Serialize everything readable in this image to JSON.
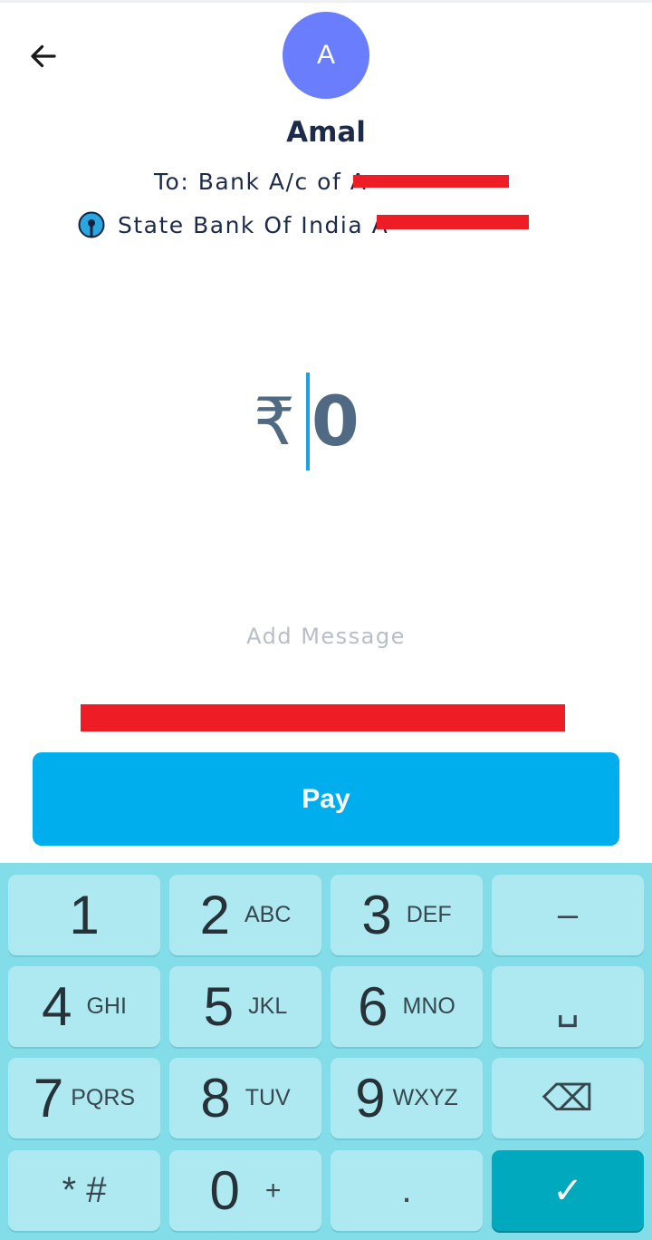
{
  "header": {
    "back_icon": "arrow-left-icon",
    "avatar_letter": "A",
    "payee_name": "Amal",
    "to_prefix": "To: Bank A/c of A",
    "bank_name": "State Bank Of India A",
    "bank_icon": "sbi-logo-icon"
  },
  "amount": {
    "currency_symbol": "₹",
    "value": "0"
  },
  "message": {
    "placeholder": "Add Message"
  },
  "pay_button": {
    "label": "Pay",
    "color": "#00aded"
  },
  "keypad": {
    "keys": [
      {
        "digit": "1",
        "letters": ""
      },
      {
        "digit": "2",
        "letters": "ABC"
      },
      {
        "digit": "3",
        "letters": "DEF"
      },
      {
        "digit": "–",
        "letters": ""
      },
      {
        "digit": "4",
        "letters": "GHI"
      },
      {
        "digit": "5",
        "letters": "JKL"
      },
      {
        "digit": "6",
        "letters": "MNO"
      },
      {
        "digit": "␣",
        "letters": ""
      },
      {
        "digit": "7",
        "letters": "PQRS"
      },
      {
        "digit": "8",
        "letters": "TUV"
      },
      {
        "digit": "9",
        "letters": "WXYZ"
      },
      {
        "digit": "⌫",
        "letters": ""
      },
      {
        "digit": "* #",
        "letters": ""
      },
      {
        "digit": "0",
        "letters": "+"
      },
      {
        "digit": ".",
        "letters": ""
      },
      {
        "digit": "✓",
        "letters": ""
      }
    ],
    "background": "#82dde8",
    "key_color": "#aee8f0",
    "done_color": "#00a9bd"
  }
}
